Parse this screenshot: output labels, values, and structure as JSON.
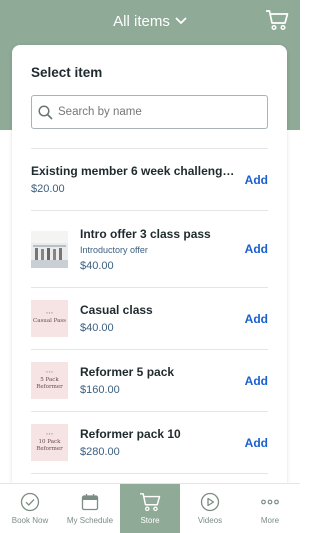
{
  "header": {
    "title": "All items"
  },
  "card": {
    "title": "Select item"
  },
  "search": {
    "placeholder": "Search by name"
  },
  "items": [
    {
      "name": "Existing member 6 week challenge…",
      "sub": "",
      "price": "$20.00",
      "add": "Add",
      "thumb": ""
    },
    {
      "name": "Intro offer 3 class pass",
      "sub": "Introductory offer",
      "price": "$40.00",
      "add": "Add",
      "thumb": "photo"
    },
    {
      "name": "Casual class",
      "sub": "",
      "price": "$40.00",
      "add": "Add",
      "thumb": "Casual Pass"
    },
    {
      "name": "Reformer 5 pack",
      "sub": "",
      "price": "$160.00",
      "add": "Add",
      "thumb": "5 Pack Reformer"
    },
    {
      "name": "Reformer pack 10",
      "sub": "",
      "price": "$280.00",
      "add": "Add",
      "thumb": "10 Pack Reformer"
    }
  ],
  "nav": [
    {
      "label": "Book Now",
      "icon": "check-circle-icon"
    },
    {
      "label": "My Schedule",
      "icon": "calendar-icon"
    },
    {
      "label": "Store",
      "icon": "cart-icon"
    },
    {
      "label": "Videos",
      "icon": "play-circle-icon"
    },
    {
      "label": "More",
      "icon": "more-dots-icon"
    }
  ],
  "colors": {
    "accent": "#8faa97",
    "link": "#1a5fd0",
    "price": "#3b5f82"
  }
}
